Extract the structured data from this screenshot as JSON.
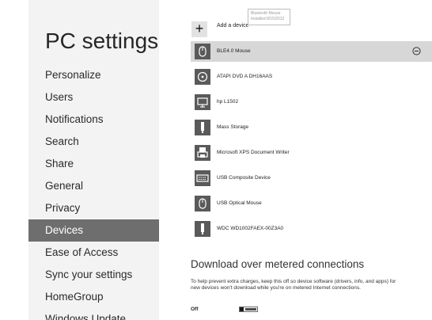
{
  "sidebar": {
    "title": "PC settings",
    "items": [
      {
        "label": "Personalize"
      },
      {
        "label": "Users"
      },
      {
        "label": "Notifications"
      },
      {
        "label": "Search"
      },
      {
        "label": "Share"
      },
      {
        "label": "General"
      },
      {
        "label": "Privacy"
      },
      {
        "label": "Devices",
        "selected": true
      },
      {
        "label": "Ease of Access"
      },
      {
        "label": "Sync your settings"
      },
      {
        "label": "HomeGroup"
      },
      {
        "label": "Windows Update"
      }
    ]
  },
  "devices": {
    "add_label": "Add a device",
    "tooltip": {
      "line1": "Bluetooth Mouse",
      "line2": "Installed 8/15/2012"
    },
    "list": [
      {
        "name": "BLE4.0 Mouse",
        "icon": "mouse-icon",
        "selected": true
      },
      {
        "name": "ATAPI DVD A  DH16AAS",
        "icon": "dvd-drive-icon"
      },
      {
        "name": "hp L1502",
        "icon": "monitor-icon"
      },
      {
        "name": "Mass Storage",
        "icon": "usb-drive-icon"
      },
      {
        "name": "Microsoft XPS Document Writer",
        "icon": "printer-icon"
      },
      {
        "name": "USB Composite Device",
        "icon": "keyboard-icon"
      },
      {
        "name": "USB Optical Mouse",
        "icon": "mouse-icon"
      },
      {
        "name": "WDC WD1002FAEX-00Z3A0",
        "icon": "usb-drive-icon"
      }
    ]
  },
  "metered": {
    "title": "Download over metered connections",
    "description": "To help prevent extra charges, keep this off so device software (drivers, info, and apps) for new devices won't download while you're on metered Internet connections.",
    "toggle_label": "Off",
    "toggle_on": false
  }
}
